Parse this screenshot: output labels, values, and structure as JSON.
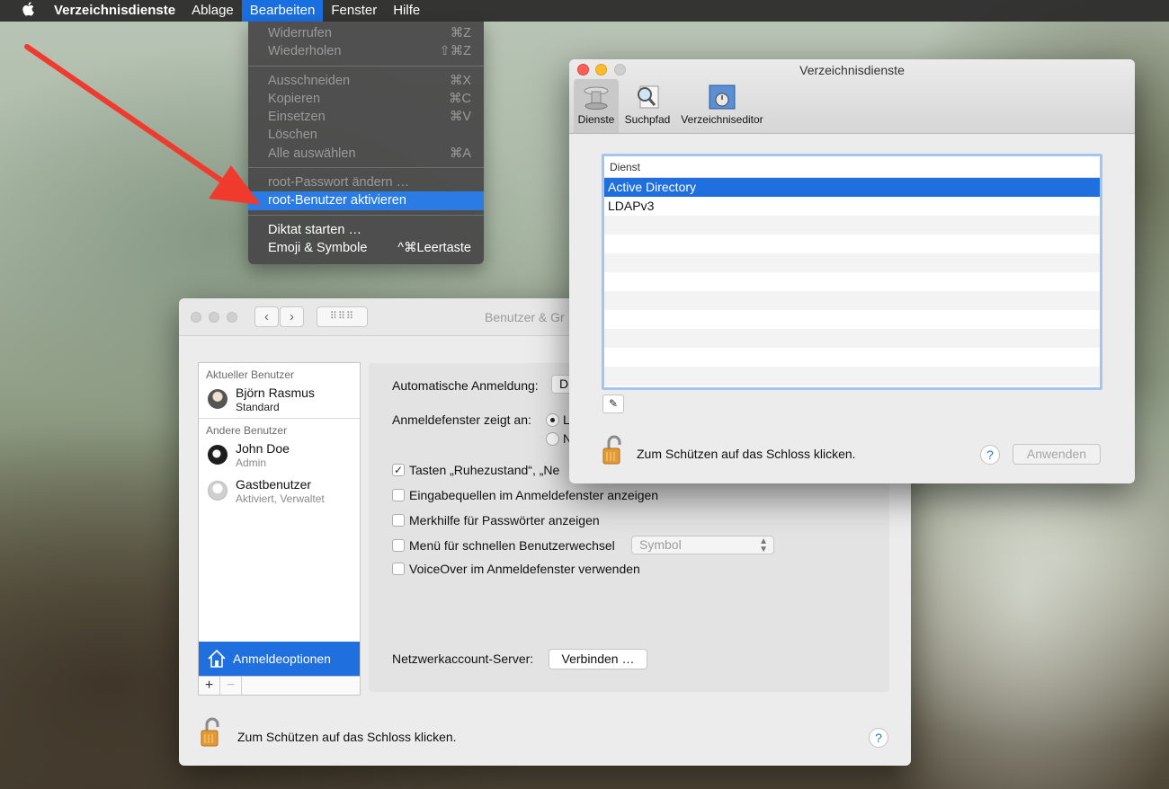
{
  "menubar": {
    "app_name": "Verzeichnisdienste",
    "items": [
      "Ablage",
      "Bearbeiten",
      "Fenster",
      "Hilfe"
    ]
  },
  "edit_menu": {
    "items": [
      {
        "label": "Widerrufen",
        "shortcut": "⌘Z",
        "enabled": false
      },
      {
        "label": "Wiederholen",
        "shortcut": "⇧⌘Z",
        "enabled": false
      },
      {
        "label": "Ausschneiden",
        "shortcut": "⌘X",
        "enabled": false
      },
      {
        "label": "Kopieren",
        "shortcut": "⌘C",
        "enabled": false
      },
      {
        "label": "Einsetzen",
        "shortcut": "⌘V",
        "enabled": false
      },
      {
        "label": "Löschen",
        "shortcut": "",
        "enabled": false
      },
      {
        "label": "Alle auswählen",
        "shortcut": "⌘A",
        "enabled": false
      },
      {
        "label": "root-Passwort ändern …",
        "shortcut": "",
        "enabled": false
      },
      {
        "label": "root-Benutzer aktivieren",
        "shortcut": "",
        "enabled": true,
        "highlighted": true
      },
      {
        "label": "Diktat starten …",
        "shortcut": "",
        "enabled": true
      },
      {
        "label": "Emoji & Symbole",
        "shortcut": "^⌘Leertaste",
        "enabled": true
      }
    ]
  },
  "users_window": {
    "title": "Benutzer & Gr",
    "current_user_heading": "Aktueller Benutzer",
    "current_user": {
      "name": "Björn Rasmus",
      "role": "Standard"
    },
    "other_users_heading": "Andere Benutzer",
    "other_users": [
      {
        "name": "John Doe",
        "role": "Admin"
      },
      {
        "name": "Gastbenutzer",
        "role": "Aktiviert, Verwaltet"
      }
    ],
    "login_options_label": "Anmeldeoptionen",
    "auto_login_label": "Automatische Anmeldung:",
    "auto_login_value": "D",
    "login_window_label": "Anmeldefenster zeigt an:",
    "login_window_option1": "L",
    "login_window_option2": "N",
    "checkboxes": [
      {
        "label": "Tasten „Ruhezustand“, „Ne",
        "checked": true
      },
      {
        "label": "Eingabequellen im Anmeldefenster anzeigen",
        "checked": false
      },
      {
        "label": "Merkhilfe für Passwörter anzeigen",
        "checked": false
      },
      {
        "label": "Menü für schnellen Benutzerwechsel",
        "checked": false
      },
      {
        "label": "VoiceOver im Anmeldefenster verwenden",
        "checked": false
      }
    ],
    "fast_switch_value": "Symbol",
    "network_server_label": "Netzwerkaccount-Server:",
    "connect_button": "Verbinden …",
    "lock_text": "Zum Schützen auf das Schloss klicken.",
    "help": "?"
  },
  "directory_window": {
    "title": "Verzeichnisdienste",
    "tabs": [
      "Dienste",
      "Suchpfad",
      "Verzeichniseditor"
    ],
    "table_header": "Dienst",
    "services": [
      "Active Directory",
      "LDAPv3"
    ],
    "lock_text": "Zum Schützen auf das Schloss klicken.",
    "apply_button": "Anwenden",
    "help": "?",
    "edit_icon": "✎"
  },
  "colors": {
    "selection_blue": "#1f6fde",
    "menu_highlight": "#2a7be4",
    "arrow_red": "#f03a2e"
  }
}
